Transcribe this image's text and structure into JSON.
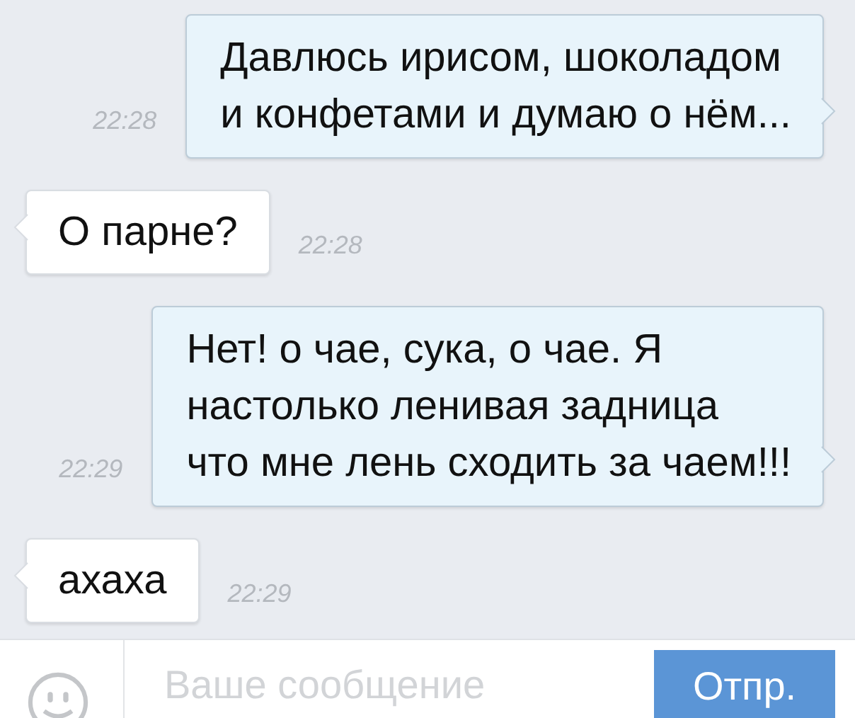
{
  "messages": [
    {
      "kind": "out",
      "text": "Давлюсь ирисом, шоколадом\nи конфетами и думаю о нём...",
      "time": "22:28"
    },
    {
      "kind": "in",
      "text": "О парне?",
      "time": "22:28"
    },
    {
      "kind": "out",
      "text": "Нет! о чае, сука, о чае. Я\nнастолько ленивая задница\nчто мне лень сходить за чаем!!!",
      "time": "22:29"
    },
    {
      "kind": "in",
      "text": "ахаха",
      "time": "22:29"
    }
  ],
  "composer": {
    "placeholder": "Ваше сообщение",
    "send_button": "Отпр."
  }
}
